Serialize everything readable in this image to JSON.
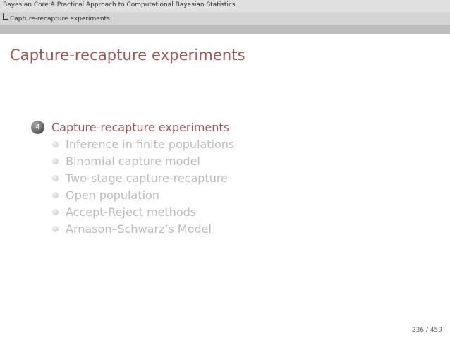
{
  "header": {
    "document_title": "Bayesian Core:A Practical Approach to Computational Bayesian Statistics",
    "section": "Capture-recapture experiments"
  },
  "frame": {
    "title": "Capture-recapture experiments"
  },
  "toc": {
    "section_number": "4",
    "section_label": "Capture-recapture experiments",
    "subsections": [
      {
        "label": "Inference in finite populations"
      },
      {
        "label": "Binomial capture model"
      },
      {
        "label": "Two-stage capture-recapture"
      },
      {
        "label": "Open population"
      },
      {
        "label": "Accept-Reject methods"
      },
      {
        "label": "Arnason–Schwarz’s Model"
      }
    ]
  },
  "footer": {
    "page": "236 / 459"
  },
  "colors": {
    "accent": "#a05555",
    "dimmed_text": "#bbbbbb"
  }
}
